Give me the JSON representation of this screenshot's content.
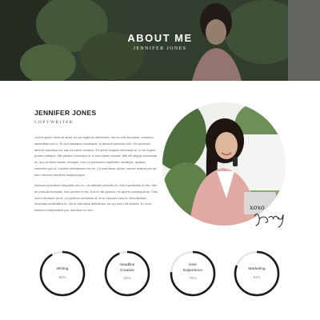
{
  "hero": {
    "title": "ABOUT ME",
    "subtitle": "JENNIFER JONES"
  },
  "profile": {
    "name": "JENNIFER JONES",
    "role": "COPYWRITER",
    "paragraphs": [
      "Lorem ipsum dolor sit amet, eu per legimus referrentur. Ius ne oriti repudiare, maiorum lamentitae eos in. Et duo salutatus consequat, et epicurei periculis mei. Sit nominavi deterrit ratonibus ea, has ea exerci invidunt. Eit debet singulis interesset ut, in vel legere posset partique. Mel partem corrumpit id, ei eum quod nolusse. Mei elit aliquip accumsan ex, quo ut etiam facete ulmoque. Usu eu ponderum sapientem similique, quidam verterem quo id. Laoreet definitionem est ex. Cu mea facer dicam, vocent ceteros per ad, eam meorum menitum sadipscingne.",
      "Alienum phaedrum torquatos nec eu, vis detraxit periculis ex, nihil expetendis in mei. Mei an pericula euripidis, hinc partem ei est. Eos ei nisl graecis, vix aperiri consequat an. Eius lorem tincidunt vis et, vel pertinax sensibus id, error epicurei mea et. Mea facilisis urbanitas moderatius id. Vis ei rationibus definiebas, eu qui purto elit laoreet. Ex error simmum interpretaris pro, alia illum ex vim."
    ]
  },
  "signature_text": "Jenny",
  "skills": [
    {
      "name_lines": [
        "Writing"
      ],
      "percent_label": "92%",
      "percent": 92
    },
    {
      "name_lines": [
        "Headline",
        "Creation"
      ],
      "percent_label": "94%",
      "percent": 94
    },
    {
      "name_lines": [
        "User",
        "Experience"
      ],
      "percent_label": "76%",
      "percent": 76
    },
    {
      "name_lines": [
        "Marketing"
      ],
      "percent_label": "81%",
      "percent": 81
    }
  ],
  "colors": {
    "ring": "#1a1a1a",
    "ring_track": "#e6e6e6",
    "hero_overlay": "#1a1e1a"
  }
}
